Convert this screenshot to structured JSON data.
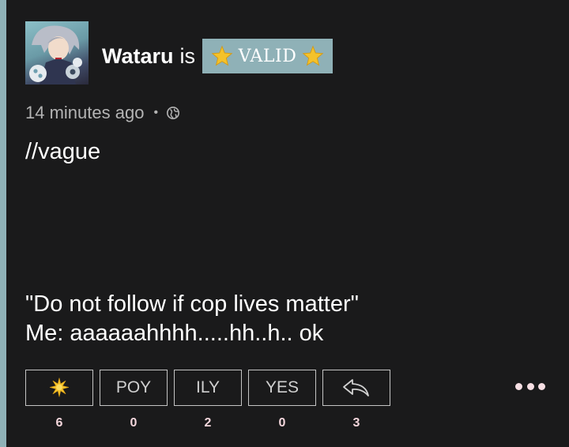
{
  "post": {
    "author": "Wataru",
    "status_verb": "is",
    "status_badge": "VALID",
    "badge_color": "#8fb1b7",
    "timestamp": "14 minutes ago",
    "separator": "•",
    "visibility_icon": "globe-icon",
    "lines": [
      "//vague",
      "\"Do not follow if cop lives matter\"",
      "Me: aaaaaahhhh.....hh..h.. ok"
    ]
  },
  "reactions": [
    {
      "label": "",
      "icon": "star-icon",
      "count": "6"
    },
    {
      "label": "POY",
      "count": "0"
    },
    {
      "label": "ILY",
      "count": "2"
    },
    {
      "label": "YES",
      "count": "0"
    },
    {
      "label": "",
      "icon": "reply-icon",
      "count": "3"
    }
  ],
  "more_icon": "more-icon"
}
